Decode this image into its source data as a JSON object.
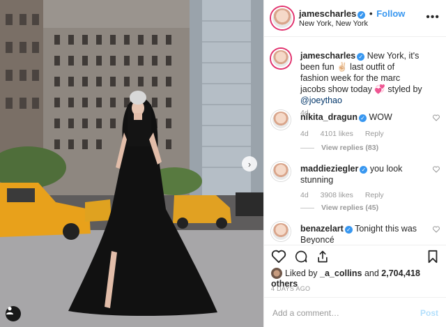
{
  "post": {
    "author": "jamescharles",
    "follow_label": "Follow",
    "separator": "•",
    "location": "New York, New York",
    "more_icon": "more-options-icon"
  },
  "caption": {
    "username": "jamescharles",
    "text_before": " New York, it's been fun ✌🏻 last outfit of fashion week for the marc jacobs show today 💞 styled by ",
    "mention": "@joeythao",
    "age": "4d"
  },
  "comments": [
    {
      "username": "nikita_dragun",
      "text": " WOW",
      "age": "4d",
      "likes": "4101 likes",
      "reply": "Reply",
      "view_replies": "View replies (83)"
    },
    {
      "username": "maddieziegler",
      "text": " you look stunning",
      "age": "4d",
      "likes": "3908 likes",
      "reply": "Reply",
      "view_replies": "View replies (45)"
    },
    {
      "username": "benazelart",
      "text": " Tonight this was Beyoncé"
    }
  ],
  "likes": {
    "prefix": "Liked by ",
    "user": "_a_collins",
    "connector": " and ",
    "count": "2,704,418 others"
  },
  "timestamp": "4 DAYS AGO",
  "comment_box": {
    "placeholder": "Add a comment…",
    "post_label": "Post"
  },
  "colors": {
    "accent": "#3897f0",
    "text": "#262626",
    "muted": "#999999",
    "post_disabled": "#b2dffc"
  }
}
